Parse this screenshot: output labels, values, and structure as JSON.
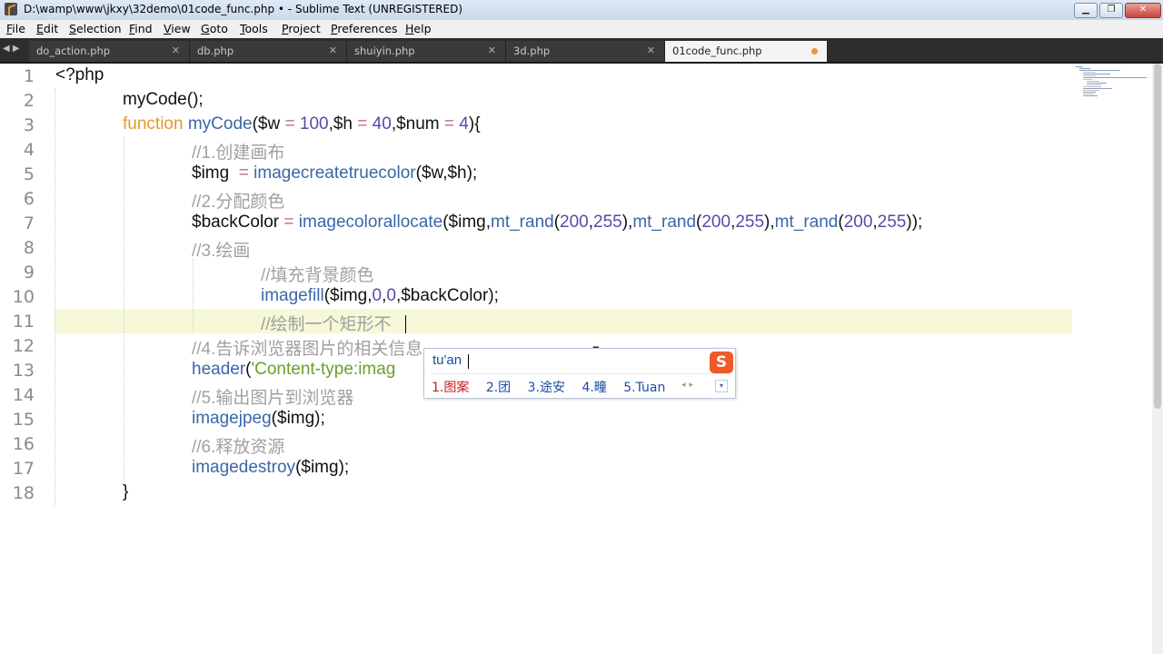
{
  "window": {
    "title": "D:\\wamp\\www\\jkxy\\32demo\\01code_func.php • - Sublime Text (UNREGISTERED)",
    "min_label": "▁",
    "max_label": "❐",
    "close_label": "✕"
  },
  "menu": [
    {
      "mn": "F",
      "rest": "ile"
    },
    {
      "mn": "E",
      "rest": "dit"
    },
    {
      "mn": "S",
      "rest": "election"
    },
    {
      "mn": "F",
      "rest": "ind"
    },
    {
      "mn": "V",
      "rest": "iew"
    },
    {
      "mn": "G",
      "rest": "oto"
    },
    {
      "mn": "T",
      "rest": "ools"
    },
    {
      "mn": "P",
      "rest": "roject"
    },
    {
      "mn": "P",
      "rest": "references"
    },
    {
      "mn": "H",
      "rest": "elp"
    }
  ],
  "tabs": [
    {
      "label": "do_action.php",
      "close": "✕"
    },
    {
      "label": "db.php",
      "close": "✕"
    },
    {
      "label": "shuiyin.php",
      "close": "✕"
    },
    {
      "label": "3d.php",
      "close": "✕"
    },
    {
      "label": "01code_func.php",
      "modified": true
    }
  ],
  "tab_nav": "◀ ▶",
  "code_lines": [
    {
      "n": "1"
    },
    {
      "n": "2"
    },
    {
      "n": "3"
    },
    {
      "n": "4"
    },
    {
      "n": "5"
    },
    {
      "n": "6"
    },
    {
      "n": "7"
    },
    {
      "n": "8"
    },
    {
      "n": "9"
    },
    {
      "n": "10"
    },
    {
      "n": "11"
    },
    {
      "n": "12"
    },
    {
      "n": "13"
    },
    {
      "n": "14"
    },
    {
      "n": "15"
    },
    {
      "n": "16"
    },
    {
      "n": "17"
    },
    {
      "n": "18"
    }
  ],
  "code": {
    "l1": "<?php",
    "l2": "myCode();",
    "l3_kw": "function",
    "l3_fn": "myCode",
    "l3_a": "($w ",
    "l3_b": " 100",
    "l3_c": ",$h ",
    "l3_d": " 40",
    "l3_e": ",$num ",
    "l3_f": " 4",
    "l3_g": "){",
    "eq": "=",
    "l4": "//1.创建画布",
    "l5_a": "$img  ",
    "l5_fn": "imagecreatetruecolor",
    "l5_b": "($w,$h);",
    "l6": "//2.分配颜色",
    "l7_a": "$backColor ",
    "l7_fn": "imagecolorallocate",
    "l7_b": "($img,",
    "mt": "mt_rand",
    "p1": "(",
    "n200": "200",
    "comma": ",",
    "n255": "255",
    "p2": "),",
    "p3": "));",
    "l8": "//3.绘画",
    "l9": "//填充背景颜色",
    "l10_fn": "imagefill",
    "l10_a": "($img,",
    "n0": "0",
    "l10_b": ",$backColor);",
    "l11": "//绘制一个矩形不",
    "l12": "//4.告诉浏览器图片的相关信息",
    "l13_fn": "header",
    "l13_a": "(",
    "l13_str": "'Content-type:imag",
    "l14": "//5.输出图片到浏览器",
    "l15_fn": "imagejpeg",
    "l15_a": "($img);",
    "l16": "//6.释放资源",
    "l17_fn": "imagedestroy",
    "l17_a": "($img);",
    "l18": "}"
  },
  "ime": {
    "input": "tu'an",
    "logo": "S",
    "candidates": [
      "1.图案",
      "2.团",
      "3.途安",
      "4.疃",
      "5.Tuan"
    ],
    "pager": "◂▸",
    "menu": "▾"
  },
  "colors": {
    "keyword": "#e39a28",
    "function": "#3a66a8",
    "number": "#5a4aa8",
    "comment": "#a0a0a0",
    "string": "#6aa028",
    "active_line": "#f6f8d8"
  }
}
